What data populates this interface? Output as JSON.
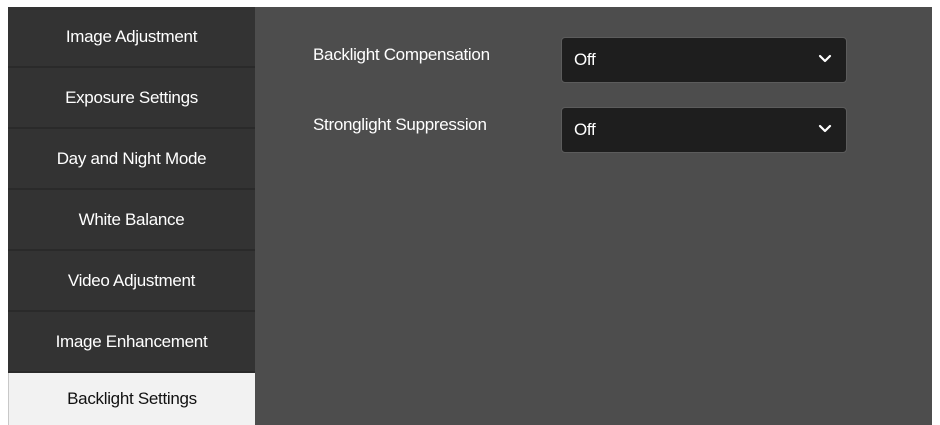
{
  "sidebar": {
    "items": [
      {
        "label": "Image Adjustment",
        "active": false
      },
      {
        "label": "Exposure Settings",
        "active": false
      },
      {
        "label": "Day and Night Mode",
        "active": false
      },
      {
        "label": "White Balance",
        "active": false
      },
      {
        "label": "Video Adjustment",
        "active": false
      },
      {
        "label": "Image Enhancement",
        "active": false
      },
      {
        "label": "Backlight Settings",
        "active": true
      }
    ]
  },
  "form": {
    "backlight_compensation": {
      "label": "Backlight Compensation",
      "value": "Off",
      "icon": "chevron-down-icon"
    },
    "stronglight_suppression": {
      "label": "Stronglight Suppression",
      "value": "Off",
      "icon": "chevron-down-icon"
    }
  },
  "colors": {
    "sidebar_bg": "#333333",
    "active_item_bg": "#f2f2f2",
    "content_bg": "#4d4d4d",
    "select_bg": "#1e1e1e"
  }
}
